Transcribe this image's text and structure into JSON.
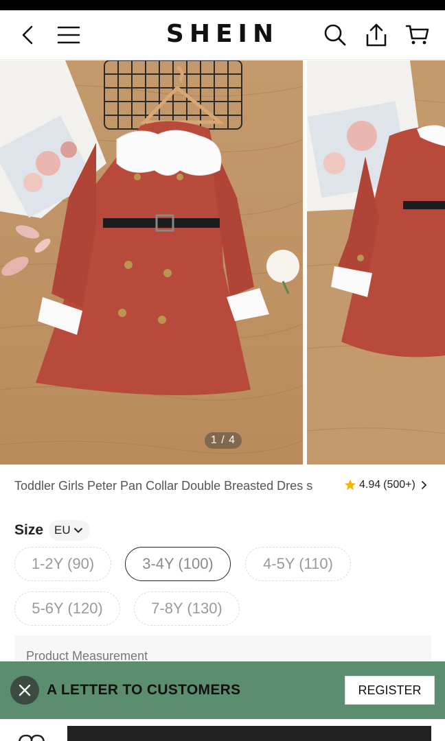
{
  "header": {
    "logo": "SHEIN",
    "icons": [
      "back-icon",
      "menu-icon",
      "search-icon",
      "share-icon",
      "cart-icon"
    ]
  },
  "gallery": {
    "counter": "1 / 4",
    "images": [
      "red-dress-main-image",
      "red-dress-side-image"
    ]
  },
  "product": {
    "title": "Toddler Girls Peter Pan Collar Double Breasted Dres s",
    "rating": "4.94",
    "review_count": "(500+)"
  },
  "size": {
    "label": "Size",
    "unit": "EU",
    "options": [
      {
        "label": "1-2Y (90)",
        "selected": false
      },
      {
        "label": "3-4Y (100)",
        "selected": true
      },
      {
        "label": "4-5Y (110)",
        "selected": false
      },
      {
        "label": "5-6Y (120)",
        "selected": false
      },
      {
        "label": "7-8Y (130)",
        "selected": false
      }
    ]
  },
  "measurement": {
    "label": "Product Measurement"
  },
  "banner": {
    "text": "A LETTER TO CUSTOMERS",
    "button": "REGISTER",
    "background": "#5a8e6e"
  },
  "colors": {
    "accent": "#222222",
    "star": "#f5b400",
    "dress": "#b84a3c"
  }
}
